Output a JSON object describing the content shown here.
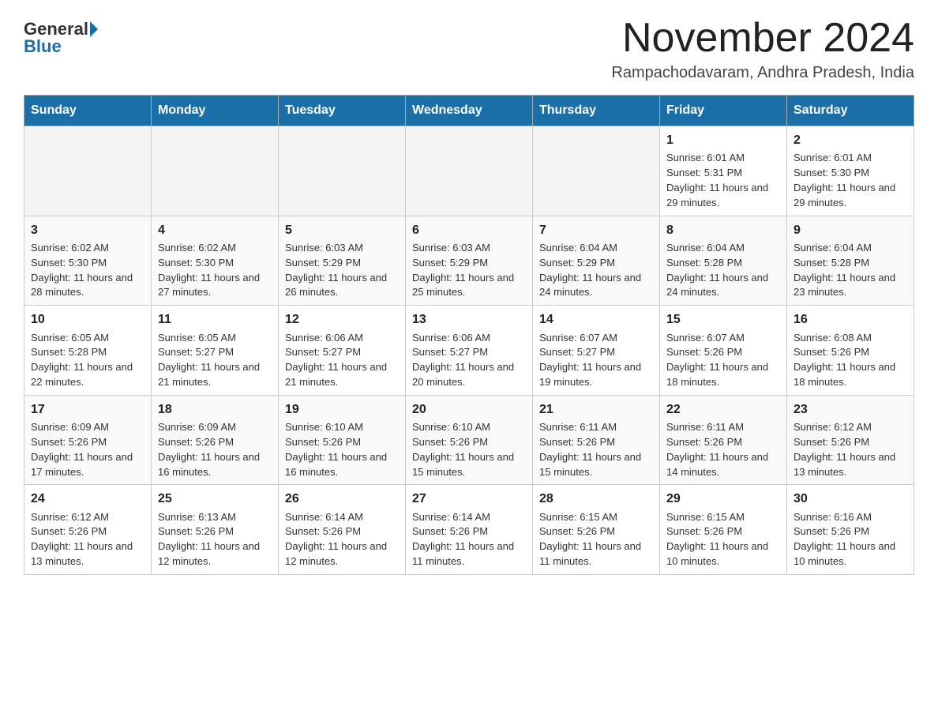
{
  "header": {
    "logo_general": "General",
    "logo_blue": "Blue",
    "month_title": "November 2024",
    "location": "Rampachodavaram, Andhra Pradesh, India"
  },
  "weekdays": [
    "Sunday",
    "Monday",
    "Tuesday",
    "Wednesday",
    "Thursday",
    "Friday",
    "Saturday"
  ],
  "weeks": [
    [
      {
        "day": "",
        "sunrise": "",
        "sunset": "",
        "daylight": ""
      },
      {
        "day": "",
        "sunrise": "",
        "sunset": "",
        "daylight": ""
      },
      {
        "day": "",
        "sunrise": "",
        "sunset": "",
        "daylight": ""
      },
      {
        "day": "",
        "sunrise": "",
        "sunset": "",
        "daylight": ""
      },
      {
        "day": "",
        "sunrise": "",
        "sunset": "",
        "daylight": ""
      },
      {
        "day": "1",
        "sunrise": "Sunrise: 6:01 AM",
        "sunset": "Sunset: 5:31 PM",
        "daylight": "Daylight: 11 hours and 29 minutes."
      },
      {
        "day": "2",
        "sunrise": "Sunrise: 6:01 AM",
        "sunset": "Sunset: 5:30 PM",
        "daylight": "Daylight: 11 hours and 29 minutes."
      }
    ],
    [
      {
        "day": "3",
        "sunrise": "Sunrise: 6:02 AM",
        "sunset": "Sunset: 5:30 PM",
        "daylight": "Daylight: 11 hours and 28 minutes."
      },
      {
        "day": "4",
        "sunrise": "Sunrise: 6:02 AM",
        "sunset": "Sunset: 5:30 PM",
        "daylight": "Daylight: 11 hours and 27 minutes."
      },
      {
        "day": "5",
        "sunrise": "Sunrise: 6:03 AM",
        "sunset": "Sunset: 5:29 PM",
        "daylight": "Daylight: 11 hours and 26 minutes."
      },
      {
        "day": "6",
        "sunrise": "Sunrise: 6:03 AM",
        "sunset": "Sunset: 5:29 PM",
        "daylight": "Daylight: 11 hours and 25 minutes."
      },
      {
        "day": "7",
        "sunrise": "Sunrise: 6:04 AM",
        "sunset": "Sunset: 5:29 PM",
        "daylight": "Daylight: 11 hours and 24 minutes."
      },
      {
        "day": "8",
        "sunrise": "Sunrise: 6:04 AM",
        "sunset": "Sunset: 5:28 PM",
        "daylight": "Daylight: 11 hours and 24 minutes."
      },
      {
        "day": "9",
        "sunrise": "Sunrise: 6:04 AM",
        "sunset": "Sunset: 5:28 PM",
        "daylight": "Daylight: 11 hours and 23 minutes."
      }
    ],
    [
      {
        "day": "10",
        "sunrise": "Sunrise: 6:05 AM",
        "sunset": "Sunset: 5:28 PM",
        "daylight": "Daylight: 11 hours and 22 minutes."
      },
      {
        "day": "11",
        "sunrise": "Sunrise: 6:05 AM",
        "sunset": "Sunset: 5:27 PM",
        "daylight": "Daylight: 11 hours and 21 minutes."
      },
      {
        "day": "12",
        "sunrise": "Sunrise: 6:06 AM",
        "sunset": "Sunset: 5:27 PM",
        "daylight": "Daylight: 11 hours and 21 minutes."
      },
      {
        "day": "13",
        "sunrise": "Sunrise: 6:06 AM",
        "sunset": "Sunset: 5:27 PM",
        "daylight": "Daylight: 11 hours and 20 minutes."
      },
      {
        "day": "14",
        "sunrise": "Sunrise: 6:07 AM",
        "sunset": "Sunset: 5:27 PM",
        "daylight": "Daylight: 11 hours and 19 minutes."
      },
      {
        "day": "15",
        "sunrise": "Sunrise: 6:07 AM",
        "sunset": "Sunset: 5:26 PM",
        "daylight": "Daylight: 11 hours and 18 minutes."
      },
      {
        "day": "16",
        "sunrise": "Sunrise: 6:08 AM",
        "sunset": "Sunset: 5:26 PM",
        "daylight": "Daylight: 11 hours and 18 minutes."
      }
    ],
    [
      {
        "day": "17",
        "sunrise": "Sunrise: 6:09 AM",
        "sunset": "Sunset: 5:26 PM",
        "daylight": "Daylight: 11 hours and 17 minutes."
      },
      {
        "day": "18",
        "sunrise": "Sunrise: 6:09 AM",
        "sunset": "Sunset: 5:26 PM",
        "daylight": "Daylight: 11 hours and 16 minutes."
      },
      {
        "day": "19",
        "sunrise": "Sunrise: 6:10 AM",
        "sunset": "Sunset: 5:26 PM",
        "daylight": "Daylight: 11 hours and 16 minutes."
      },
      {
        "day": "20",
        "sunrise": "Sunrise: 6:10 AM",
        "sunset": "Sunset: 5:26 PM",
        "daylight": "Daylight: 11 hours and 15 minutes."
      },
      {
        "day": "21",
        "sunrise": "Sunrise: 6:11 AM",
        "sunset": "Sunset: 5:26 PM",
        "daylight": "Daylight: 11 hours and 15 minutes."
      },
      {
        "day": "22",
        "sunrise": "Sunrise: 6:11 AM",
        "sunset": "Sunset: 5:26 PM",
        "daylight": "Daylight: 11 hours and 14 minutes."
      },
      {
        "day": "23",
        "sunrise": "Sunrise: 6:12 AM",
        "sunset": "Sunset: 5:26 PM",
        "daylight": "Daylight: 11 hours and 13 minutes."
      }
    ],
    [
      {
        "day": "24",
        "sunrise": "Sunrise: 6:12 AM",
        "sunset": "Sunset: 5:26 PM",
        "daylight": "Daylight: 11 hours and 13 minutes."
      },
      {
        "day": "25",
        "sunrise": "Sunrise: 6:13 AM",
        "sunset": "Sunset: 5:26 PM",
        "daylight": "Daylight: 11 hours and 12 minutes."
      },
      {
        "day": "26",
        "sunrise": "Sunrise: 6:14 AM",
        "sunset": "Sunset: 5:26 PM",
        "daylight": "Daylight: 11 hours and 12 minutes."
      },
      {
        "day": "27",
        "sunrise": "Sunrise: 6:14 AM",
        "sunset": "Sunset: 5:26 PM",
        "daylight": "Daylight: 11 hours and 11 minutes."
      },
      {
        "day": "28",
        "sunrise": "Sunrise: 6:15 AM",
        "sunset": "Sunset: 5:26 PM",
        "daylight": "Daylight: 11 hours and 11 minutes."
      },
      {
        "day": "29",
        "sunrise": "Sunrise: 6:15 AM",
        "sunset": "Sunset: 5:26 PM",
        "daylight": "Daylight: 11 hours and 10 minutes."
      },
      {
        "day": "30",
        "sunrise": "Sunrise: 6:16 AM",
        "sunset": "Sunset: 5:26 PM",
        "daylight": "Daylight: 11 hours and 10 minutes."
      }
    ]
  ]
}
